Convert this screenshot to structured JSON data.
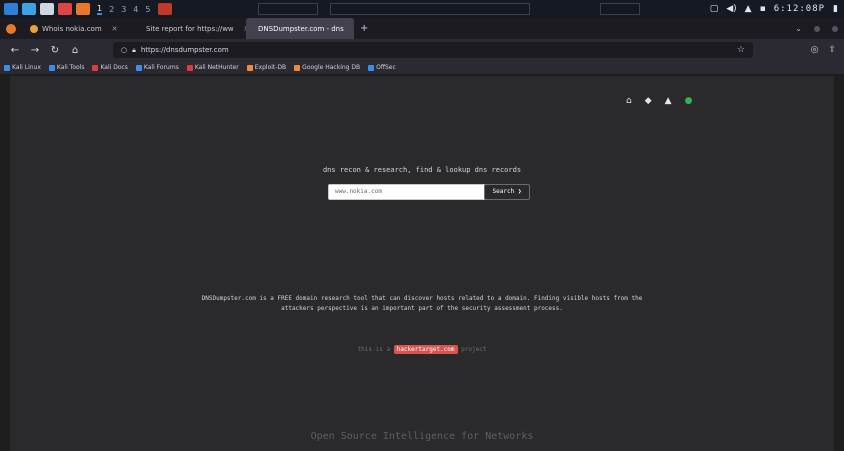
{
  "system_panel": {
    "workspaces": [
      "1",
      "2",
      "3",
      "4",
      "5"
    ],
    "active_workspace": "1",
    "clock": "6:12:08P"
  },
  "browser": {
    "tabs": [
      {
        "label": "Whois nokia.com"
      },
      {
        "label": "Site report for https://ww"
      },
      {
        "label": "DNSDumpster.com - dns"
      }
    ],
    "new_tab": "+",
    "url": "https://dnsdumpster.com",
    "bookmarks": [
      {
        "label": "Kali Linux",
        "color": "#3a8ee6"
      },
      {
        "label": "Kali Tools",
        "color": "#3a8ee6"
      },
      {
        "label": "Kali Docs",
        "color": "#e03b3b"
      },
      {
        "label": "Kali Forums",
        "color": "#3a8ee6"
      },
      {
        "label": "Kali NetHunter",
        "color": "#e03b3b"
      },
      {
        "label": "Exploit-DB",
        "color": "#f0883e"
      },
      {
        "label": "Google Hacking DB",
        "color": "#f0883e"
      },
      {
        "label": "OffSec",
        "color": "#3a8ee6"
      }
    ]
  },
  "page": {
    "tagline": "dns recon & research, find & lookup dns records",
    "search_value": "www.nokia.com",
    "search_button": "Search ❯",
    "description_line1": "DNSDumpster.com is a FREE domain research tool that can discover hosts related to a domain. Finding visible hosts from the",
    "description_line2": "attackers perspective is an important part of the security assessment process.",
    "project_prefix": "this is a",
    "project_badge": "hackertarget.com",
    "project_suffix": "project",
    "footer": "Open Source Intelligence for Networks"
  },
  "colors": {
    "accent_green": "#37b24d",
    "badge_red": "#d9534f"
  }
}
